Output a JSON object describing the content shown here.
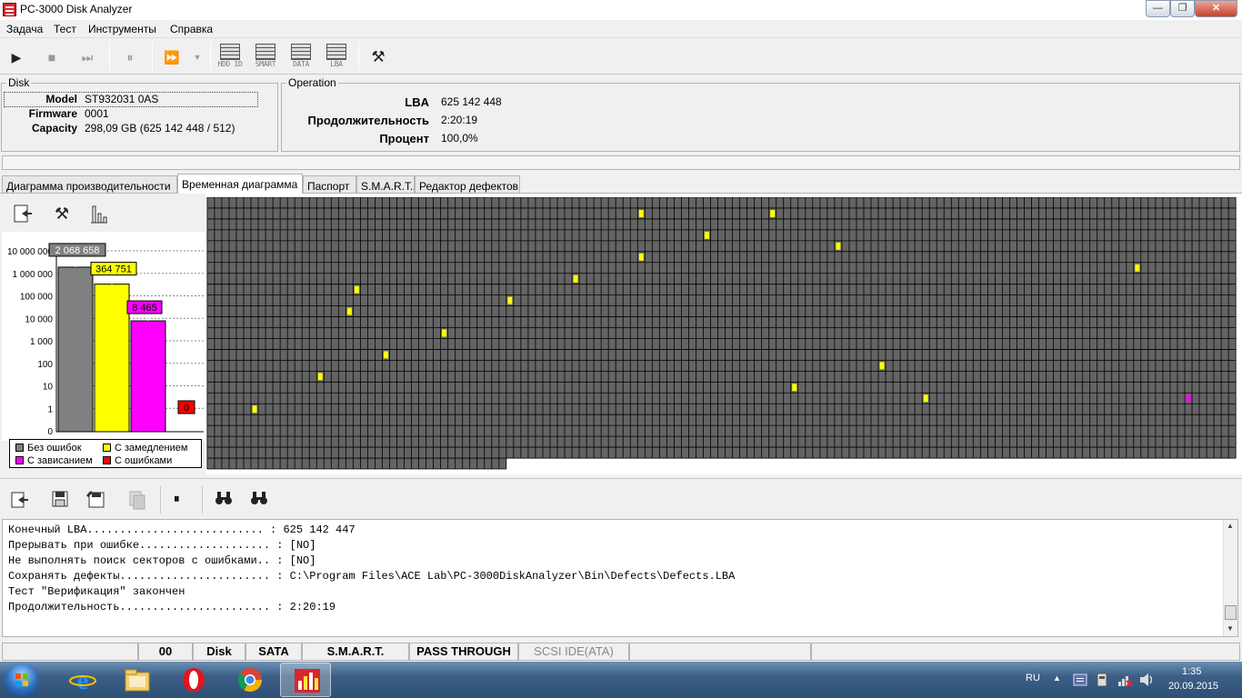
{
  "window": {
    "title": "PC-3000 Disk Analyzer"
  },
  "menu": [
    "Задача",
    "Тест",
    "Инструменты",
    "Справка"
  ],
  "toolbar": {
    "icons": [
      {
        "name": "play-icon",
        "glyph": "▶"
      },
      {
        "name": "stop-icon",
        "glyph": "■"
      },
      {
        "name": "skip-end-icon",
        "glyph": "⏭"
      },
      {
        "name": "pause-icon",
        "glyph": "⏸"
      },
      {
        "name": "fast-forward-icon",
        "glyph": "⏩"
      },
      {
        "name": "dropdown-arrow-icon",
        "glyph": "▼"
      }
    ],
    "mode_buttons": [
      "HDD ID",
      "SMART",
      "DATA",
      "LBA"
    ],
    "tools_glyph": "⚒"
  },
  "disk": {
    "legend": "Disk",
    "model_label": "Model",
    "model_value": "ST932031 0AS",
    "firmware_label": "Firmware",
    "firmware_value": "0001",
    "capacity_label": "Capacity",
    "capacity_value": "298,09 GB (625 142 448 / 512)"
  },
  "operation": {
    "legend": "Operation",
    "lba_label": "LBA",
    "lba_value": "625 142 448",
    "duration_label": "Продолжительность",
    "duration_value": "2:20:19",
    "percent_label": "Процент",
    "percent_value": "100,0%"
  },
  "tabs": [
    "Диаграмма производительности",
    "Временная диаграмма",
    "Паспорт",
    "S.M.A.R.T.",
    "Редактор дефектов"
  ],
  "active_tab": 1,
  "chart_data": {
    "type": "bar",
    "y_scale": "log",
    "yticks": [
      "10 000 000",
      "1 000 000",
      "100 000",
      "10 000",
      "1 000",
      "100",
      "10",
      "1",
      "0"
    ],
    "series": [
      {
        "name": "Без ошибок",
        "value": 2068658,
        "label": "2 068 658",
        "color": "#808080"
      },
      {
        "name": "С замедлением",
        "value": 364751,
        "label": "364 751",
        "color": "#ffff00"
      },
      {
        "name": "С зависанием",
        "value": 8465,
        "label": "8 465",
        "color": "#ff00ff"
      },
      {
        "name": "С ошибками",
        "value": 0,
        "label": "0",
        "color": "#ff0000"
      }
    ],
    "grid": "dashed horizontal",
    "legend_placement": "bottom"
  },
  "block_map": {
    "columns": 141,
    "full_rows": 24,
    "last_row_cells": 41,
    "base_color": "#646464",
    "grid_color": "#000000",
    "yellow_cells": [
      [
        1,
        59
      ],
      [
        1,
        77
      ],
      [
        3,
        68
      ],
      [
        4,
        86
      ],
      [
        5,
        59
      ],
      [
        6,
        127
      ],
      [
        7,
        50
      ],
      [
        8,
        20
      ],
      [
        9,
        41
      ],
      [
        10,
        19
      ],
      [
        12,
        32
      ],
      [
        14,
        24
      ],
      [
        15,
        92
      ],
      [
        16,
        15
      ],
      [
        17,
        80
      ],
      [
        18,
        98
      ],
      [
        19,
        6
      ]
    ],
    "magenta_cells": [
      [
        18,
        134
      ]
    ]
  },
  "log_toolbar_icons": [
    "open-file-icon",
    "save-icon",
    "save-as-icon",
    "copy-icon",
    "pause-icon",
    "find-icon",
    "find-next-icon"
  ],
  "log": {
    "lines": [
      "Конечный LBA........................... : 625 142 447",
      "Прерывать при ошибке.................... : [NO]",
      "Не выполнять поиск секторов с ошибками.. : [NO]",
      "Сохранять дефекты....................... : C:\\Program Files\\ACE Lab\\PC-3000DiskAnalyzer\\Bin\\Defects\\Defects.LBA",
      "Тест \"Верификация\" закончен",
      "Продолжительность....................... : 2:20:19"
    ]
  },
  "status": [
    "00",
    "Disk",
    "SATA",
    "S.M.A.R.T.",
    "PASS THROUGH",
    "SCSI IDE(ATA)"
  ],
  "taskbar": {
    "lang": "RU",
    "time": "1:35",
    "date": "20.09.2015"
  }
}
